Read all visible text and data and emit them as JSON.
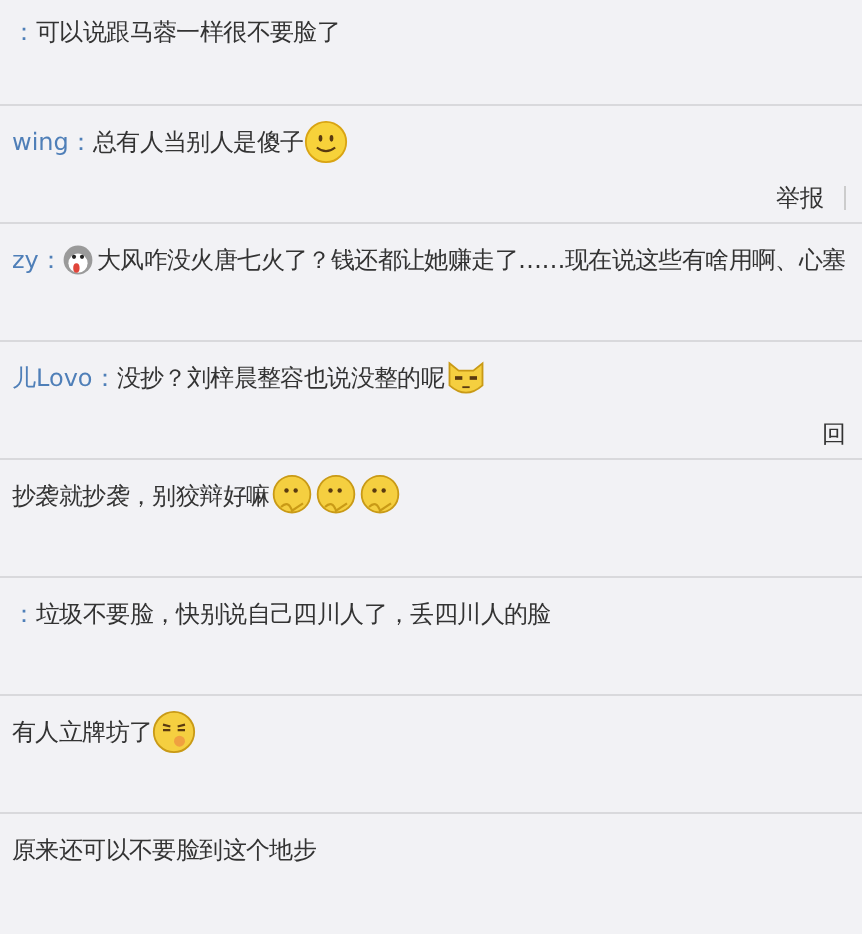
{
  "comments": [
    {
      "user": "：",
      "text": "可以说跟马蓉一样很不要脸了"
    },
    {
      "user": "wing：",
      "text": "总有人当别人是傻子",
      "emoji_after": [
        {
          "kind": "smile"
        }
      ],
      "actions": [
        "举报"
      ]
    },
    {
      "user": "zy：",
      "text": "大风咋没火唐七火了？钱还都让她赚走了……现在说这些有啥用啊、心塞",
      "emoji_before": [
        {
          "kind": "dog"
        }
      ]
    },
    {
      "user": "儿Lovo：",
      "text": "没抄？刘梓晨整容也说没整的呢",
      "emoji_after": [
        {
          "kind": "cat"
        }
      ],
      "actions": [
        "回"
      ]
    },
    {
      "text": "抄袭就抄袭，别狡辩好嘛",
      "emoji_after": [
        {
          "kind": "think"
        },
        {
          "kind": "think"
        },
        {
          "kind": "think"
        }
      ]
    },
    {
      "user": "：",
      "text": "垃圾不要脸，快别说自己四川人了，丢四川人的脸"
    },
    {
      "text": "有人立牌坊了",
      "emoji_after": [
        {
          "kind": "shy"
        }
      ]
    },
    {
      "text": "原来还可以不要脸到这个地步"
    }
  ]
}
